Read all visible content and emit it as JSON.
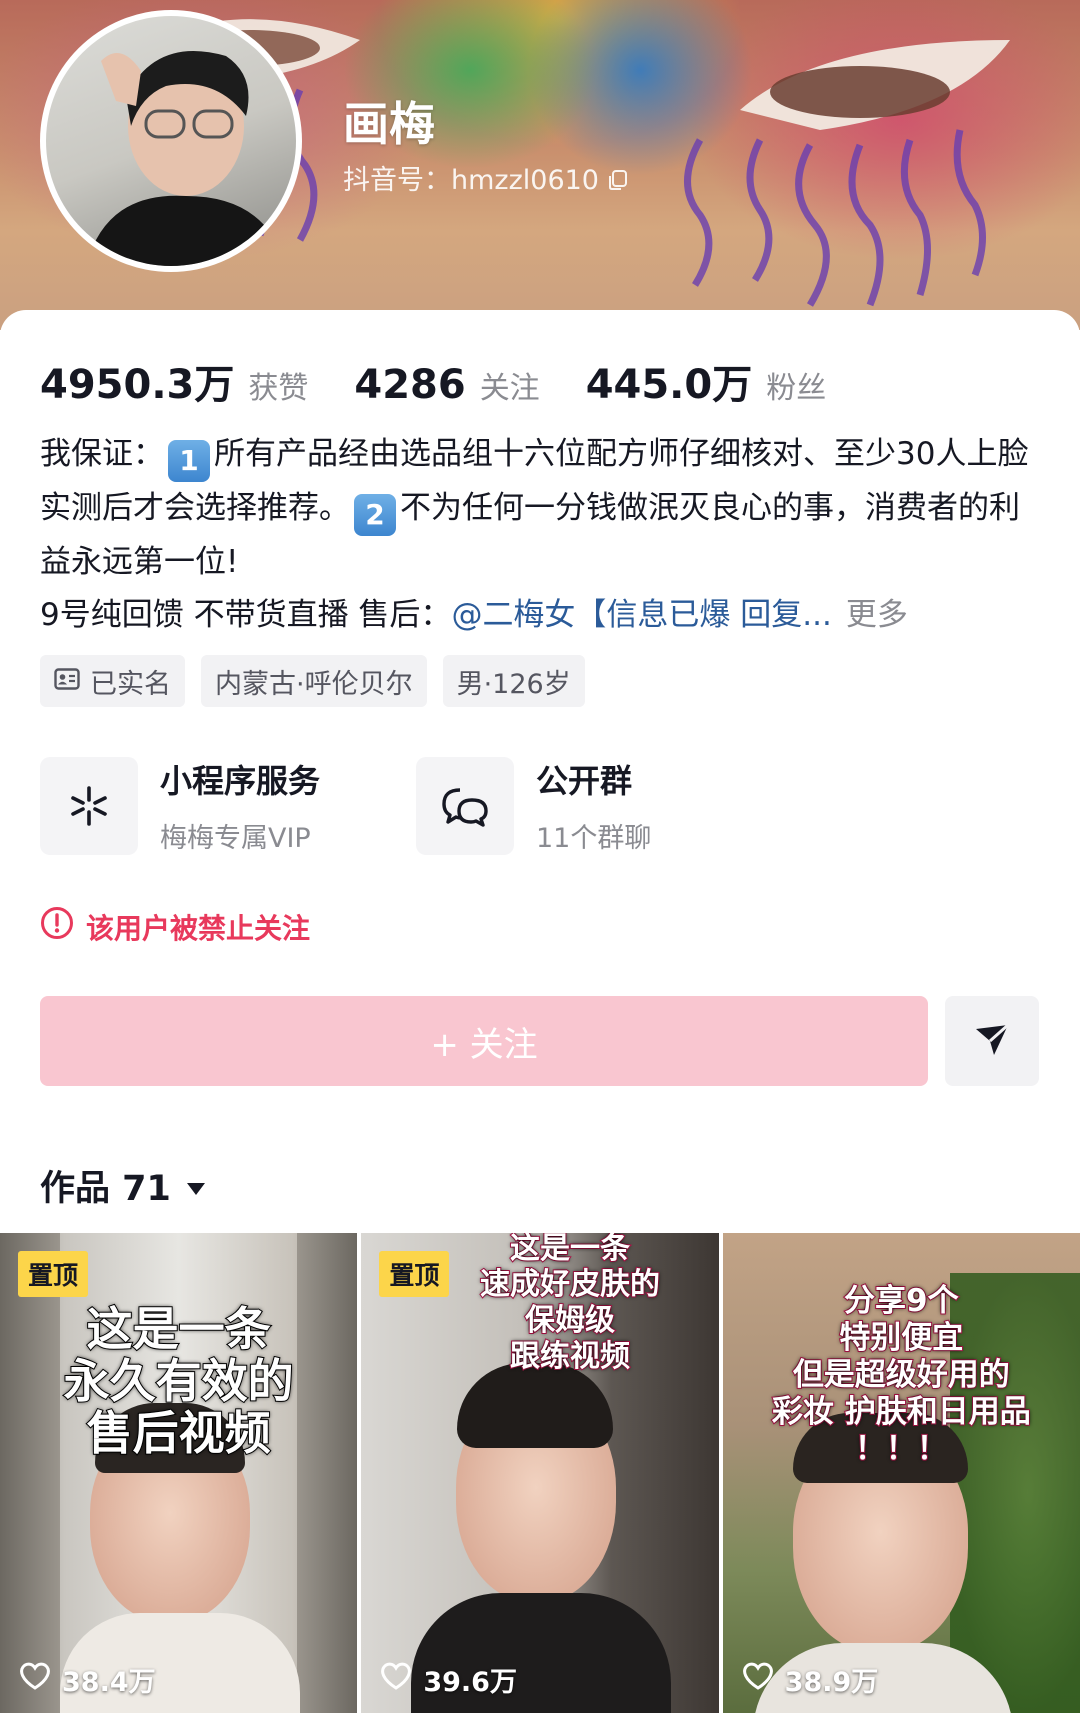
{
  "profile": {
    "name": "画梅",
    "douyin_id": "抖音号：hmzzl0610"
  },
  "stats": [
    {
      "value": "4950.3万",
      "label": "获赞"
    },
    {
      "value": "4286",
      "label": "关注"
    },
    {
      "value": "445.0万",
      "label": "粉丝"
    }
  ],
  "bio": {
    "line1_prefix": "我保证：",
    "badge1": "1",
    "line1_text": "所有产品经由选品组十六位配方师仔细核对、至少30人上脸实测后才会选择推荐。",
    "badge2": "2",
    "line2_text": "不为任何一分钱做泯灭良心的事，消费者的利益永远第一位!",
    "line3_text": "9号纯回馈 不带货直播 售后：",
    "mention": "@二梅女【信息已爆 回复...",
    "more": "更多"
  },
  "tags": [
    "已实名",
    "内蒙古·呼伦贝尔",
    "男·126岁"
  ],
  "services": [
    {
      "title": "小程序服务",
      "subtitle": "梅梅专属VIP",
      "icon": "mini-program-icon"
    },
    {
      "title": "公开群",
      "subtitle": "11个群聊",
      "icon": "group-chat-icon"
    }
  ],
  "warning": "该用户被禁止关注",
  "follow_button": "+ 关注",
  "works_tab": "作品 71",
  "videos": [
    {
      "pinned": "置顶",
      "caption": [
        "这是一条",
        "永久有效的",
        "售后视频"
      ],
      "likes": "38.4万"
    },
    {
      "pinned": "置顶",
      "caption": [
        "这是一条",
        "速成好皮肤的",
        "保姆级",
        "跟练视频"
      ],
      "likes": "39.6万"
    },
    {
      "pinned": "",
      "caption": [
        "分享9个",
        "特别便宜",
        "但是超级好用的",
        "彩妆 护肤和日用品",
        "！！！"
      ],
      "likes": "38.9万"
    }
  ],
  "colors": {
    "accent_pink": "#e8395c",
    "follow_button_bg": "#f9c6d0",
    "mention_blue": "#2b5b99",
    "pin_badge": "#fcd54a"
  }
}
